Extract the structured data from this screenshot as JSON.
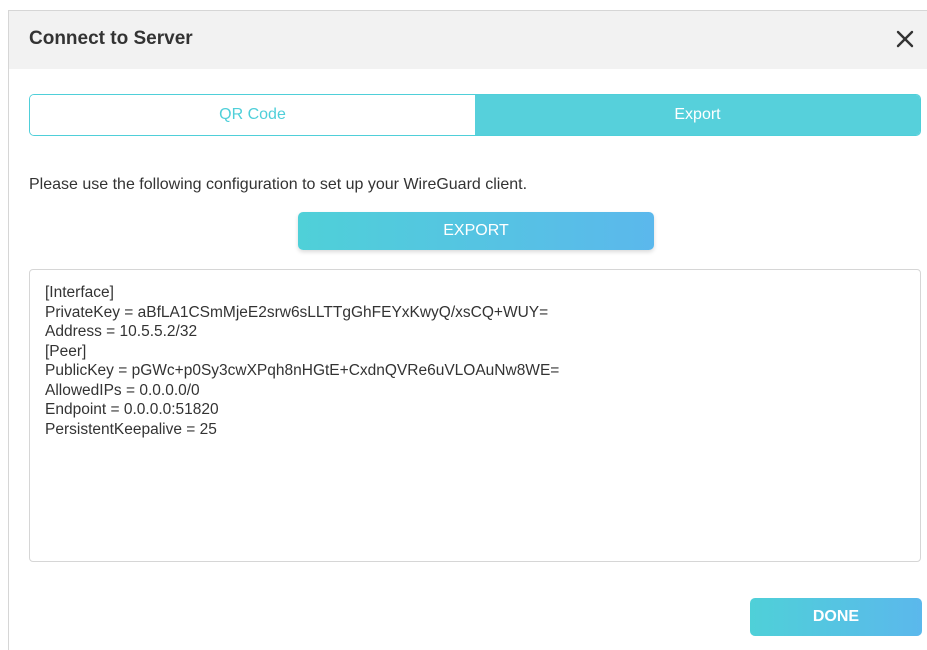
{
  "dialog": {
    "title": "Connect to Server"
  },
  "icons": {
    "close": "close-icon"
  },
  "tabs": [
    {
      "label": "QR Code",
      "active": false
    },
    {
      "label": "Export",
      "active": true
    }
  ],
  "instructions": "Please use the following configuration to set up your WireGuard client.",
  "export_button": "EXPORT",
  "config_lines": [
    "[Interface]",
    "PrivateKey = aBfLA1CSmMjeE2srw6sLLTTgGhFEYxKwyQ/xsCQ+WUY=",
    "Address = 10.5.5.2/32",
    "[Peer]",
    "PublicKey = pGWc+p0Sy3cwXPqh8nHGtE+CxdnQVRe6uVLOAuNw8WE=",
    "AllowedIPs = 0.0.0.0/0",
    "Endpoint = 0.0.0.0:51820",
    "PersistentKeepalive = 25"
  ],
  "done_button": "DONE",
  "colors": {
    "accent": "#56d0db",
    "accent_gradient_end": "#5bb8ec",
    "header_bg": "#f2f2f2",
    "text": "#333333"
  }
}
